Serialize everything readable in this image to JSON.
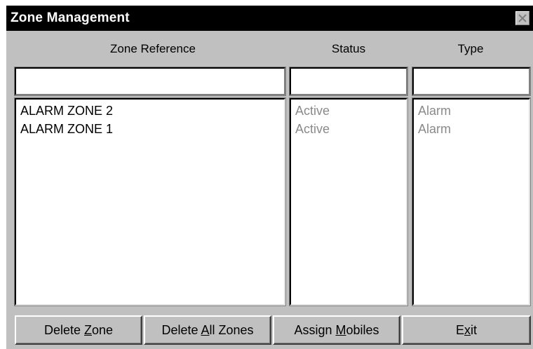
{
  "window": {
    "title": "Zone Management",
    "close_icon": "close-x-icon"
  },
  "columns": {
    "zone_reference": "Zone Reference",
    "status": "Status",
    "type": "Type"
  },
  "filters": {
    "zone_reference": "",
    "status": "",
    "type": ""
  },
  "rows": [
    {
      "zone": "ALARM ZONE 2",
      "status": "Active",
      "type": "Alarm"
    },
    {
      "zone": "ALARM ZONE 1",
      "status": "Active",
      "type": "Alarm"
    }
  ],
  "buttons": {
    "delete_zone": {
      "before": "Delete ",
      "accel": "Z",
      "after": "one"
    },
    "delete_all_zones": {
      "before": "Delete ",
      "accel": "A",
      "after": "ll Zones"
    },
    "assign_mobiles": {
      "before": "Assign ",
      "accel": "M",
      "after": "obiles"
    },
    "exit": {
      "before": "E",
      "accel": "x",
      "after": "it"
    }
  },
  "colors": {
    "titlebar": "#000000",
    "face": "#c0c0c0",
    "dim_text": "#8a8a8a"
  }
}
